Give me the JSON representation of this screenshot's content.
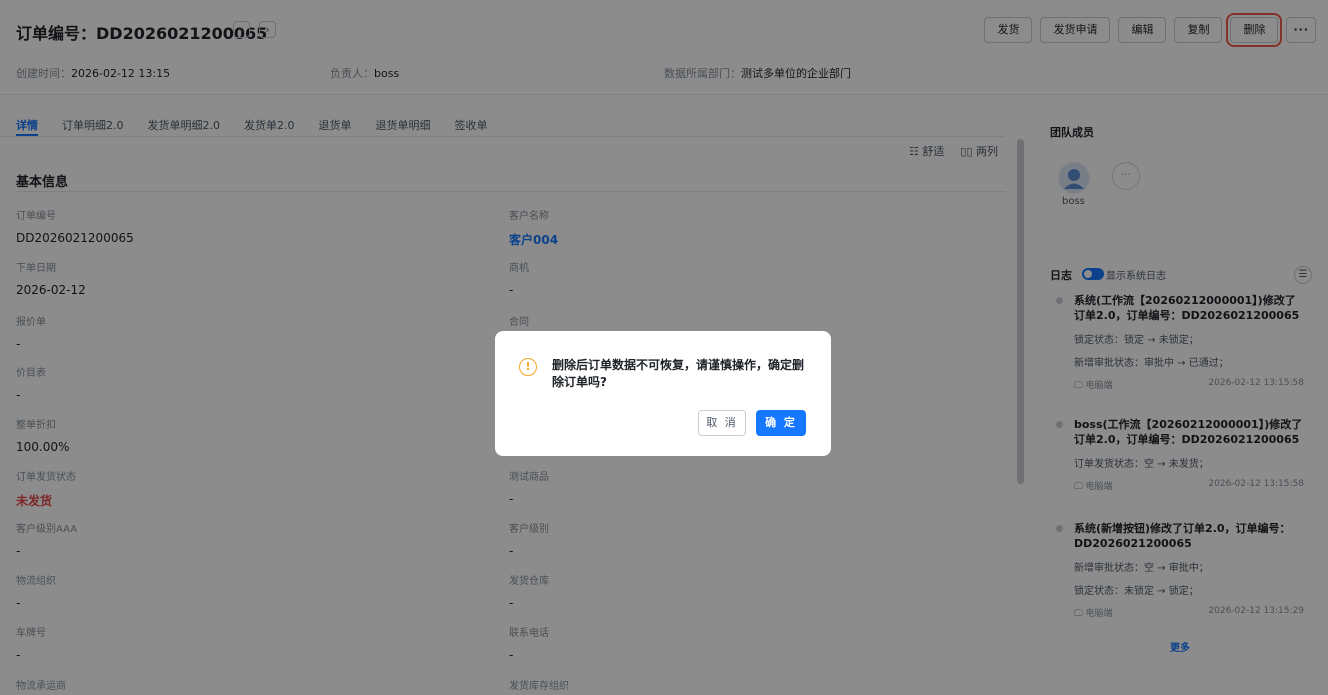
{
  "header": {
    "title": "订单编号：DD2026021200065",
    "prev_icon": "‹",
    "next_icon": "›",
    "actions": [
      "发货",
      "发货申请",
      "编辑",
      "复制",
      "删除"
    ],
    "more_icon": "···",
    "meta": {
      "created_label": "创建时间：",
      "created_value": "2026-02-12 13:15",
      "owner_label": "负责人：",
      "owner_value": "boss",
      "dept_label": "数据所属部门：",
      "dept_value": "测试多单位的企业部门"
    }
  },
  "tabs": [
    "详情",
    "订单明细2.0",
    "发货单明细2.0",
    "发货单2.0",
    "退货单",
    "退货单明细",
    "签收单"
  ],
  "layout_switch": {
    "comfortable": "舒适",
    "two_col": "两列"
  },
  "section_title": "基本信息",
  "fields_left": [
    {
      "label": "订单编号",
      "value": "DD2026021200065"
    },
    {
      "label": "下单日期",
      "value": "2026-02-12"
    },
    {
      "label": "报价单",
      "value": "-"
    },
    {
      "label": "价目表",
      "value": "-"
    },
    {
      "label": "整单折扣",
      "value": "100.00%"
    },
    {
      "label": "订单发货状态",
      "value": "未发货"
    },
    {
      "label": "客户级别AAA",
      "value": "-"
    },
    {
      "label": "物流组织",
      "value": "-"
    },
    {
      "label": "车牌号",
      "value": "-"
    },
    {
      "label": "物流承运商",
      "value": ""
    }
  ],
  "fields_right": [
    {
      "label": "客户名称",
      "value": "客户004"
    },
    {
      "label": "商机",
      "value": "-"
    },
    {
      "label": "合同",
      "value": ""
    },
    {
      "label": "测试商品",
      "value": "-"
    },
    {
      "label": "客户级别",
      "value": "-"
    },
    {
      "label": "发货仓库",
      "value": "-"
    },
    {
      "label": "联系电话",
      "value": "-"
    },
    {
      "label": "发货库存组织",
      "value": ""
    }
  ],
  "team": {
    "title": "团队成员",
    "member": "boss",
    "more_icon": "···"
  },
  "logs": {
    "title": "日志",
    "toggle_label": "显示系统日志",
    "list_icon": "☰",
    "items": [
      {
        "text": "系统(工作流【20260212000001】)修改了订单2.0，订单编号：DD2026021200065",
        "changes": [
          "锁定状态：锁定 → 未锁定；",
          "新增审批状态：审批中 → 已通过；"
        ],
        "device": "电脑端",
        "time": "2026-02-12 13:15:58"
      },
      {
        "text": "boss(工作流【20260212000001】)修改了订单2.0，订单编号：DD2026021200065",
        "changes": [
          "订单发货状态：空 → 未发货；"
        ],
        "device": "电脑端",
        "time": "2026-02-12 13:15:58"
      },
      {
        "text": "系统(新增按钮)修改了订单2.0，订单编号：DD2026021200065",
        "changes": [
          "新增审批状态：空 → 审批中；",
          "锁定状态：未锁定 → 锁定；"
        ],
        "device": "电脑端",
        "time": "2026-02-12 13:15:29"
      }
    ],
    "more": "更多"
  },
  "modal": {
    "icon": "!",
    "message": "删除后订单数据不可恢复，请谨慎操作，确定删除订单吗?",
    "cancel": "取 消",
    "ok": "确 定"
  }
}
